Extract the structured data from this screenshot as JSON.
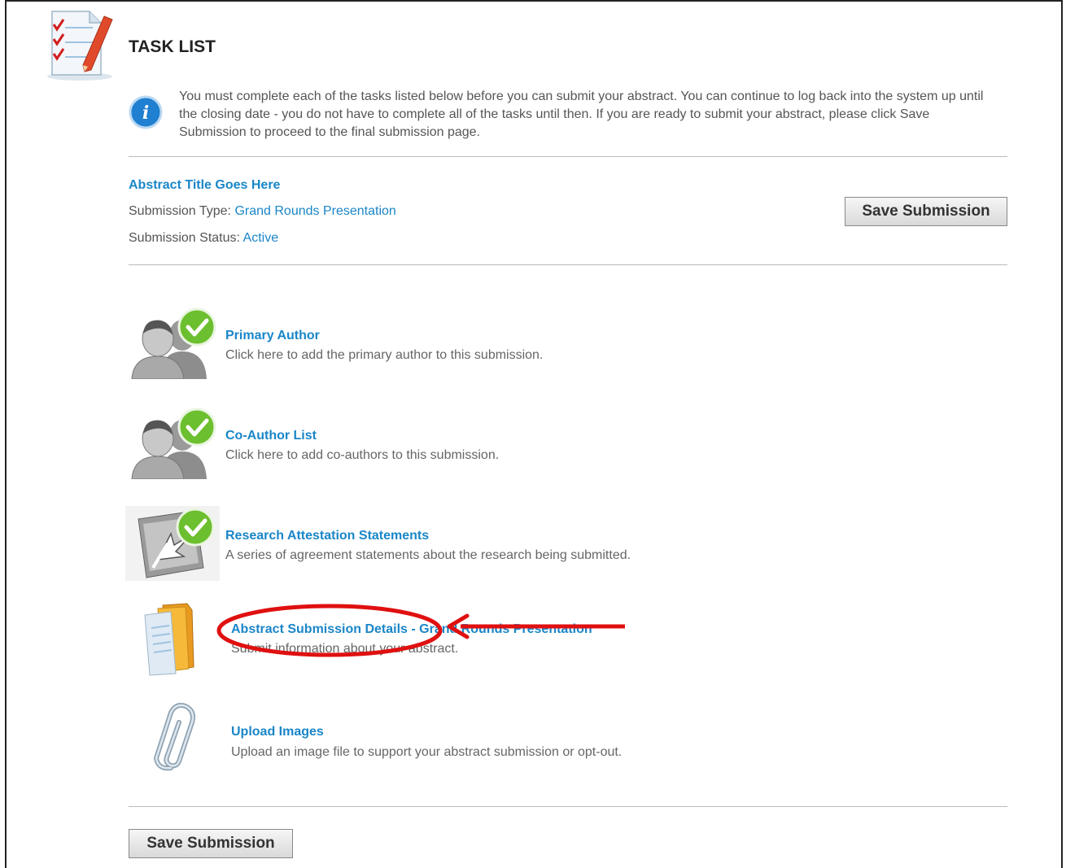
{
  "header": {
    "title": "TASK LIST",
    "info_text": "You must complete each of the tasks listed below before you can submit your abstract. You can continue to log back into the system up until the closing date - you do not have to complete all of the tasks until then. If you are ready to submit your abstract, please click Save Submission to proceed to the final submission page."
  },
  "submission": {
    "abstract_title": "Abstract Title Goes Here",
    "type_label": "Submission Type:",
    "type_value": "Grand Rounds Presentation",
    "status_label": "Submission Status:",
    "status_value": "Active",
    "save_label": "Save Submission"
  },
  "tasks": [
    {
      "title": "Primary Author",
      "desc": "Click here to add the primary author to this submission.",
      "icon": "author-checked-icon"
    },
    {
      "title": "Co-Author List",
      "desc": "Click here to add co-authors to this submission.",
      "icon": "coauthor-checked-icon"
    },
    {
      "title": "Research Attestation Statements",
      "desc": "A series of agreement statements about the research being submitted.",
      "icon": "attestation-checked-icon"
    },
    {
      "title": "Abstract Submission Details - Grand Rounds Presentation",
      "desc": "Submit information about your abstract.",
      "icon": "folder-documents-icon"
    },
    {
      "title": "Upload Images",
      "desc": "Upload an image file to support your abstract submission or opt-out.",
      "icon": "paperclip-icon"
    }
  ],
  "footer": {
    "save_label": "Save Submission"
  },
  "colors": {
    "link": "#1a86c8",
    "annotation": "#e01010",
    "check": "#6cbf2e"
  }
}
